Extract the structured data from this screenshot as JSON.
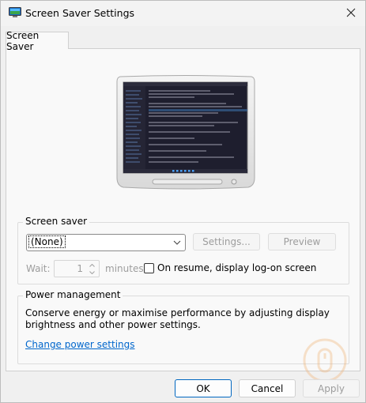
{
  "window": {
    "title": "Screen Saver Settings",
    "title_icon": "screen-saver-app-icon",
    "close_icon": "close-icon"
  },
  "tabs": [
    {
      "label": "Screen Saver",
      "selected": true
    }
  ],
  "screen_saver": {
    "group_label": "Screen saver",
    "selected": "(None)",
    "settings_button": "Settings...",
    "preview_button": "Preview",
    "wait_label": "Wait:",
    "wait_value": "1",
    "minutes_label": "minutes",
    "resume_checkbox_label": "On resume, display log-on screen",
    "resume_checked": false
  },
  "power": {
    "group_label": "Power management",
    "description": "Conserve energy or maximise performance by adjusting display brightness and other power settings.",
    "link": "Change power settings"
  },
  "buttons": {
    "ok": "OK",
    "cancel": "Cancel",
    "apply": "Apply"
  },
  "colors": {
    "link": "#0066cc",
    "accent": "#0067c0",
    "disabled_text": "#9d9d9d"
  }
}
